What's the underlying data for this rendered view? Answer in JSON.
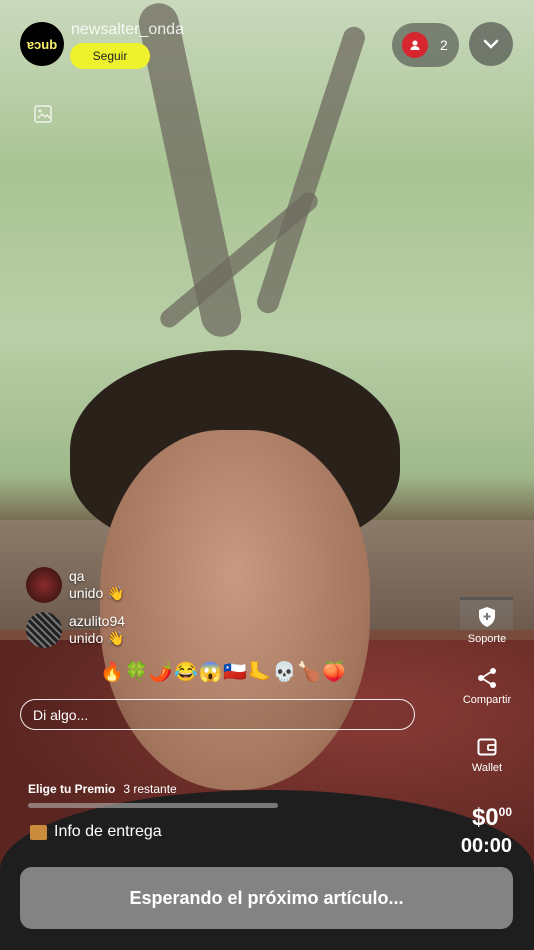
{
  "header": {
    "avatar_text": "ɐɔub",
    "username": "newsalter_onda",
    "follow_label": "Seguir",
    "viewer_count": "2"
  },
  "comments": [
    {
      "user": "qa",
      "message": "unido 👋"
    },
    {
      "user": "azulito94",
      "message": "unido 👋"
    }
  ],
  "reactions": [
    "🔥",
    "🍀",
    "🌶️",
    "😂",
    "😱",
    "🇨🇱",
    "🦶",
    "💀",
    "🍗",
    "🍑"
  ],
  "chat_input": {
    "placeholder": "Di algo..."
  },
  "side_actions": {
    "support": "Soporte",
    "share": "Compartir",
    "wallet": "Wallet"
  },
  "prize": {
    "title": "Elige tu Premio",
    "remaining": "3 restante",
    "progress": 0
  },
  "delivery_label": "Info de entrega",
  "price": {
    "amount": "$0",
    "cents": "00"
  },
  "timer": "00:00",
  "waiting_label": "Esperando el próximo artículo...",
  "colors": {
    "follow": "#eef22c",
    "viewer_icon": "#d7262e"
  }
}
